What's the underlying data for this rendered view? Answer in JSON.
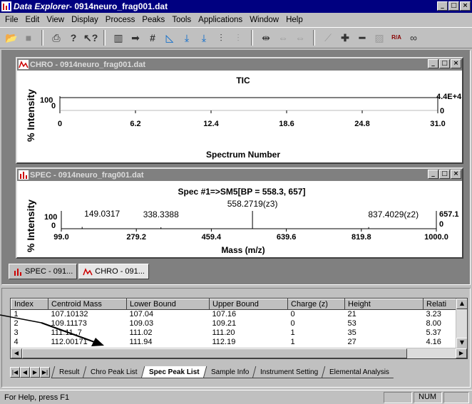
{
  "app": {
    "title_app": "Data Explorer",
    "title_file": " - 0914neuro_frag001.dat"
  },
  "window_buttons": [
    "_",
    "□",
    "×"
  ],
  "menu": [
    "File",
    "Edit",
    "View",
    "Display",
    "Process",
    "Peaks",
    "Tools",
    "Applications",
    "Window",
    "Help"
  ],
  "toolbar_icons": [
    "open-icon",
    "save-icon",
    "print-icon",
    "help-icon",
    "context-help-icon",
    "chart1-icon",
    "arrow-right-icon",
    "hash-icon",
    "chart2-icon",
    "download1-icon",
    "download2-icon",
    "chart3-icon",
    "chart4-icon",
    "expand-icon",
    "compress-icon",
    "shift-icon",
    "baseline-icon",
    "plus-icon",
    "minus-icon",
    "chart5-icon",
    "ra-icon",
    "link-icon"
  ],
  "chro": {
    "title": "CHRO - 0914neuro_frag001.dat",
    "plot_title": "TIC",
    "y_label": "% Intensity",
    "y_ticks": [
      "100",
      "0"
    ],
    "right_top": "4.4E+4",
    "right_bottom": "0",
    "x_ticks": [
      "0",
      "6.2",
      "12.4",
      "18.6",
      "24.8",
      "31.0"
    ],
    "x_label": "Spectrum Number"
  },
  "spec": {
    "title": "SPEC - 0914neuro_frag001.dat",
    "plot_title": "Spec #1=>SM5[BP = 558.3, 657]",
    "y_label": "% Intensity",
    "y_ticks": [
      "100",
      "0"
    ],
    "right_top": "657.1",
    "right_bottom": "0",
    "peak_labels": [
      "149.0317",
      "338.3388",
      "558.2719(z3)",
      "837.4029(z2)"
    ],
    "x_ticks": [
      "99.0",
      "279.2",
      "459.4",
      "639.6",
      "819.8",
      "1000.0"
    ],
    "x_label": "Mass (m/z)"
  },
  "chart_data": [
    {
      "type": "line",
      "title": "TIC",
      "xlabel": "Spectrum Number",
      "ylabel": "% Intensity",
      "xlim": [
        0,
        31.0
      ],
      "ylim": [
        0,
        100
      ],
      "x": [
        0,
        6.2,
        12.4,
        18.6,
        24.8,
        31.0
      ],
      "y": [
        100,
        100,
        100,
        100,
        100,
        100
      ]
    },
    {
      "type": "bar",
      "title": "Spec #1=>SM5[BP = 558.3, 657]",
      "xlabel": "Mass (m/z)",
      "ylabel": "% Intensity",
      "xlim": [
        99.0,
        1000.0
      ],
      "ylim": [
        0,
        100
      ],
      "x": [
        149.0317,
        338.3388,
        558.2719,
        837.4029
      ],
      "y": [
        10,
        8,
        100,
        9
      ]
    }
  ],
  "tasks": [
    {
      "label": "SPEC - 091...",
      "active": false
    },
    {
      "label": "CHRO - 091...",
      "active": true
    }
  ],
  "table": {
    "columns": [
      "Index",
      "Centroid Mass",
      "Lower Bound",
      "Upper Bound",
      "Charge (z)",
      "Height",
      "Relati"
    ],
    "rows": [
      [
        "1",
        "107.10132",
        "107.04",
        "107.16",
        "0",
        "21",
        "3.23"
      ],
      [
        "2",
        "109.11173",
        "109.03",
        "109.21",
        "0",
        "53",
        "8.00"
      ],
      [
        "3",
        "111.11..7",
        "111.02",
        "111.20",
        "1",
        "35",
        "5.37"
      ],
      [
        "4",
        "112.00171",
        "111.94",
        "112.19",
        "1",
        "27",
        "4.16"
      ]
    ]
  },
  "tabs": [
    "Result",
    "Chro Peak List",
    "Spec Peak List",
    "Sample Info",
    "Instrument Setting",
    "Elemental Analysis"
  ],
  "active_tab": "Spec Peak List",
  "status": {
    "text": "For Help, press F1",
    "num": "NUM"
  }
}
